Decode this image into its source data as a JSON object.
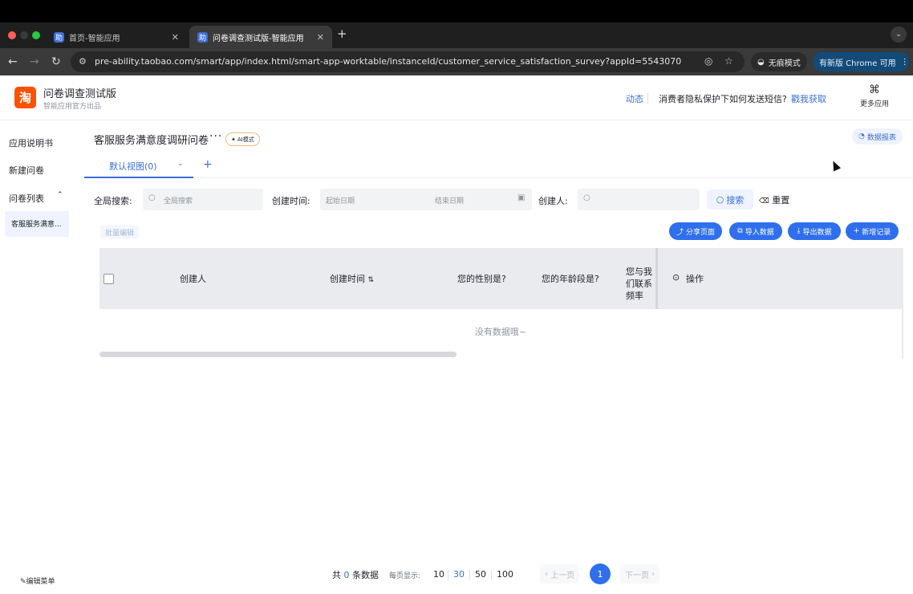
{
  "browser": {
    "tabs": [
      {
        "title": "首页-智能应用",
        "favicon": "助",
        "active": false
      },
      {
        "title": "问卷调查测试版-智能应用",
        "favicon": "助",
        "active": true
      }
    ],
    "url": "pre-ability.taobao.com/smart/app/index.html/smart-app-worktable/instanceId/customer_service_satisfaction_survey?appId=5543070",
    "incognito_label": "无痕模式",
    "update_label": "有新版 Chrome 可用"
  },
  "header": {
    "logo_text": "淘",
    "app_title": "问卷调查测试版",
    "app_subtitle": "智能应用官方出品",
    "news_link": "动态",
    "notice_text": "消费者隐私保护下如何发送短信?",
    "notice_link": "戳我获取",
    "more_apps": "更多应用"
  },
  "sidebar": {
    "items": [
      {
        "label": "应用说明书"
      },
      {
        "label": "新建问卷"
      },
      {
        "label": "问卷列表"
      }
    ],
    "sub_item": "客服服务满意...",
    "edit_menu": "编辑菜单"
  },
  "main": {
    "title": "客服服务满意度调研问卷",
    "ai_badge": "AI模式",
    "report_button": "数据报表",
    "view_tab": "默认视图(0)",
    "add_view": "+",
    "filters": {
      "global_label": "全局搜索:",
      "global_placeholder": "全局搜索",
      "time_label": "创建时间:",
      "start_placeholder": "起始日期",
      "end_placeholder": "结束日期",
      "creator_label": "创建人:",
      "search_button": "搜索",
      "reset_button": "重置"
    },
    "toolbar": {
      "batch_edit": "批量编辑",
      "share": "分享页面",
      "import": "导入数据",
      "export": "导出数据",
      "add": "新增记录"
    },
    "table": {
      "columns": [
        "创建人",
        "创建时间",
        "您的性别是?",
        "您的年龄段是?",
        "您与我们联系频率",
        "操作"
      ],
      "empty_text": "没有数据哦~"
    },
    "pagination": {
      "total_prefix": "共",
      "total": "0",
      "total_suffix": "条数据",
      "per_page_label": "每页显示:",
      "sizes": [
        "10",
        "30",
        "50",
        "100"
      ],
      "selected_size": "30",
      "prev": "上一页",
      "next": "下一页",
      "current": "1"
    }
  },
  "colors": {
    "accent": "#2f6fed",
    "brand": "#ff5000"
  }
}
